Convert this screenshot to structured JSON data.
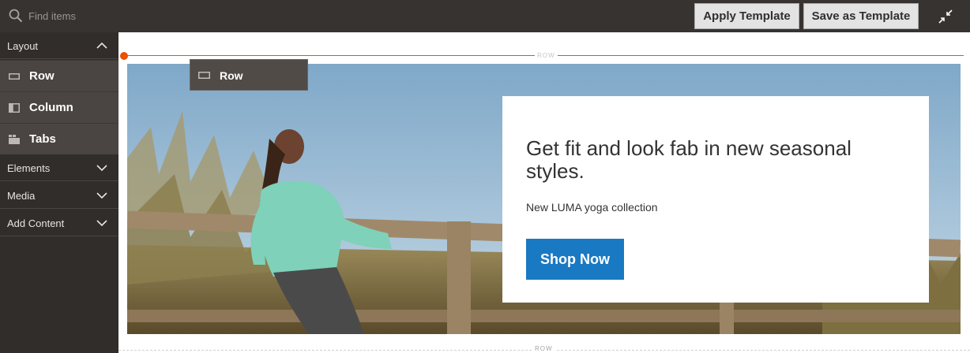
{
  "search": {
    "placeholder": "Find items"
  },
  "toolbar": {
    "apply_template_label": "Apply Template",
    "save_as_template_label": "Save as Template",
    "fullscreen_icon": "collapse-fullscreen-icon"
  },
  "sidebar": {
    "layout": {
      "label": "Layout",
      "expanded": true,
      "items": [
        {
          "label": "Row",
          "icon": "row-icon"
        },
        {
          "label": "Column",
          "icon": "column-icon"
        },
        {
          "label": "Tabs",
          "icon": "tabs-icon"
        }
      ]
    },
    "sections": [
      {
        "label": "Elements",
        "expanded": false
      },
      {
        "label": "Media",
        "expanded": false
      },
      {
        "label": "Add Content",
        "expanded": false
      }
    ]
  },
  "stage": {
    "row_label_top": "ROW",
    "row_label_bottom": "ROW",
    "drop_indicator_color": "#eb5202",
    "banner": {
      "title": "Get fit and look fab in new seasonal styles.",
      "subtitle": "New LUMA yoga collection",
      "button_label": "Shop Now",
      "button_color": "#1979c3"
    }
  },
  "drag_ghost": {
    "label": "Row",
    "icon": "row-icon"
  },
  "colors": {
    "topbar": "#373330",
    "sidebar": "#302d2a",
    "sidebar_item": "#4a4542",
    "button_bg": "#e3e3e3"
  }
}
